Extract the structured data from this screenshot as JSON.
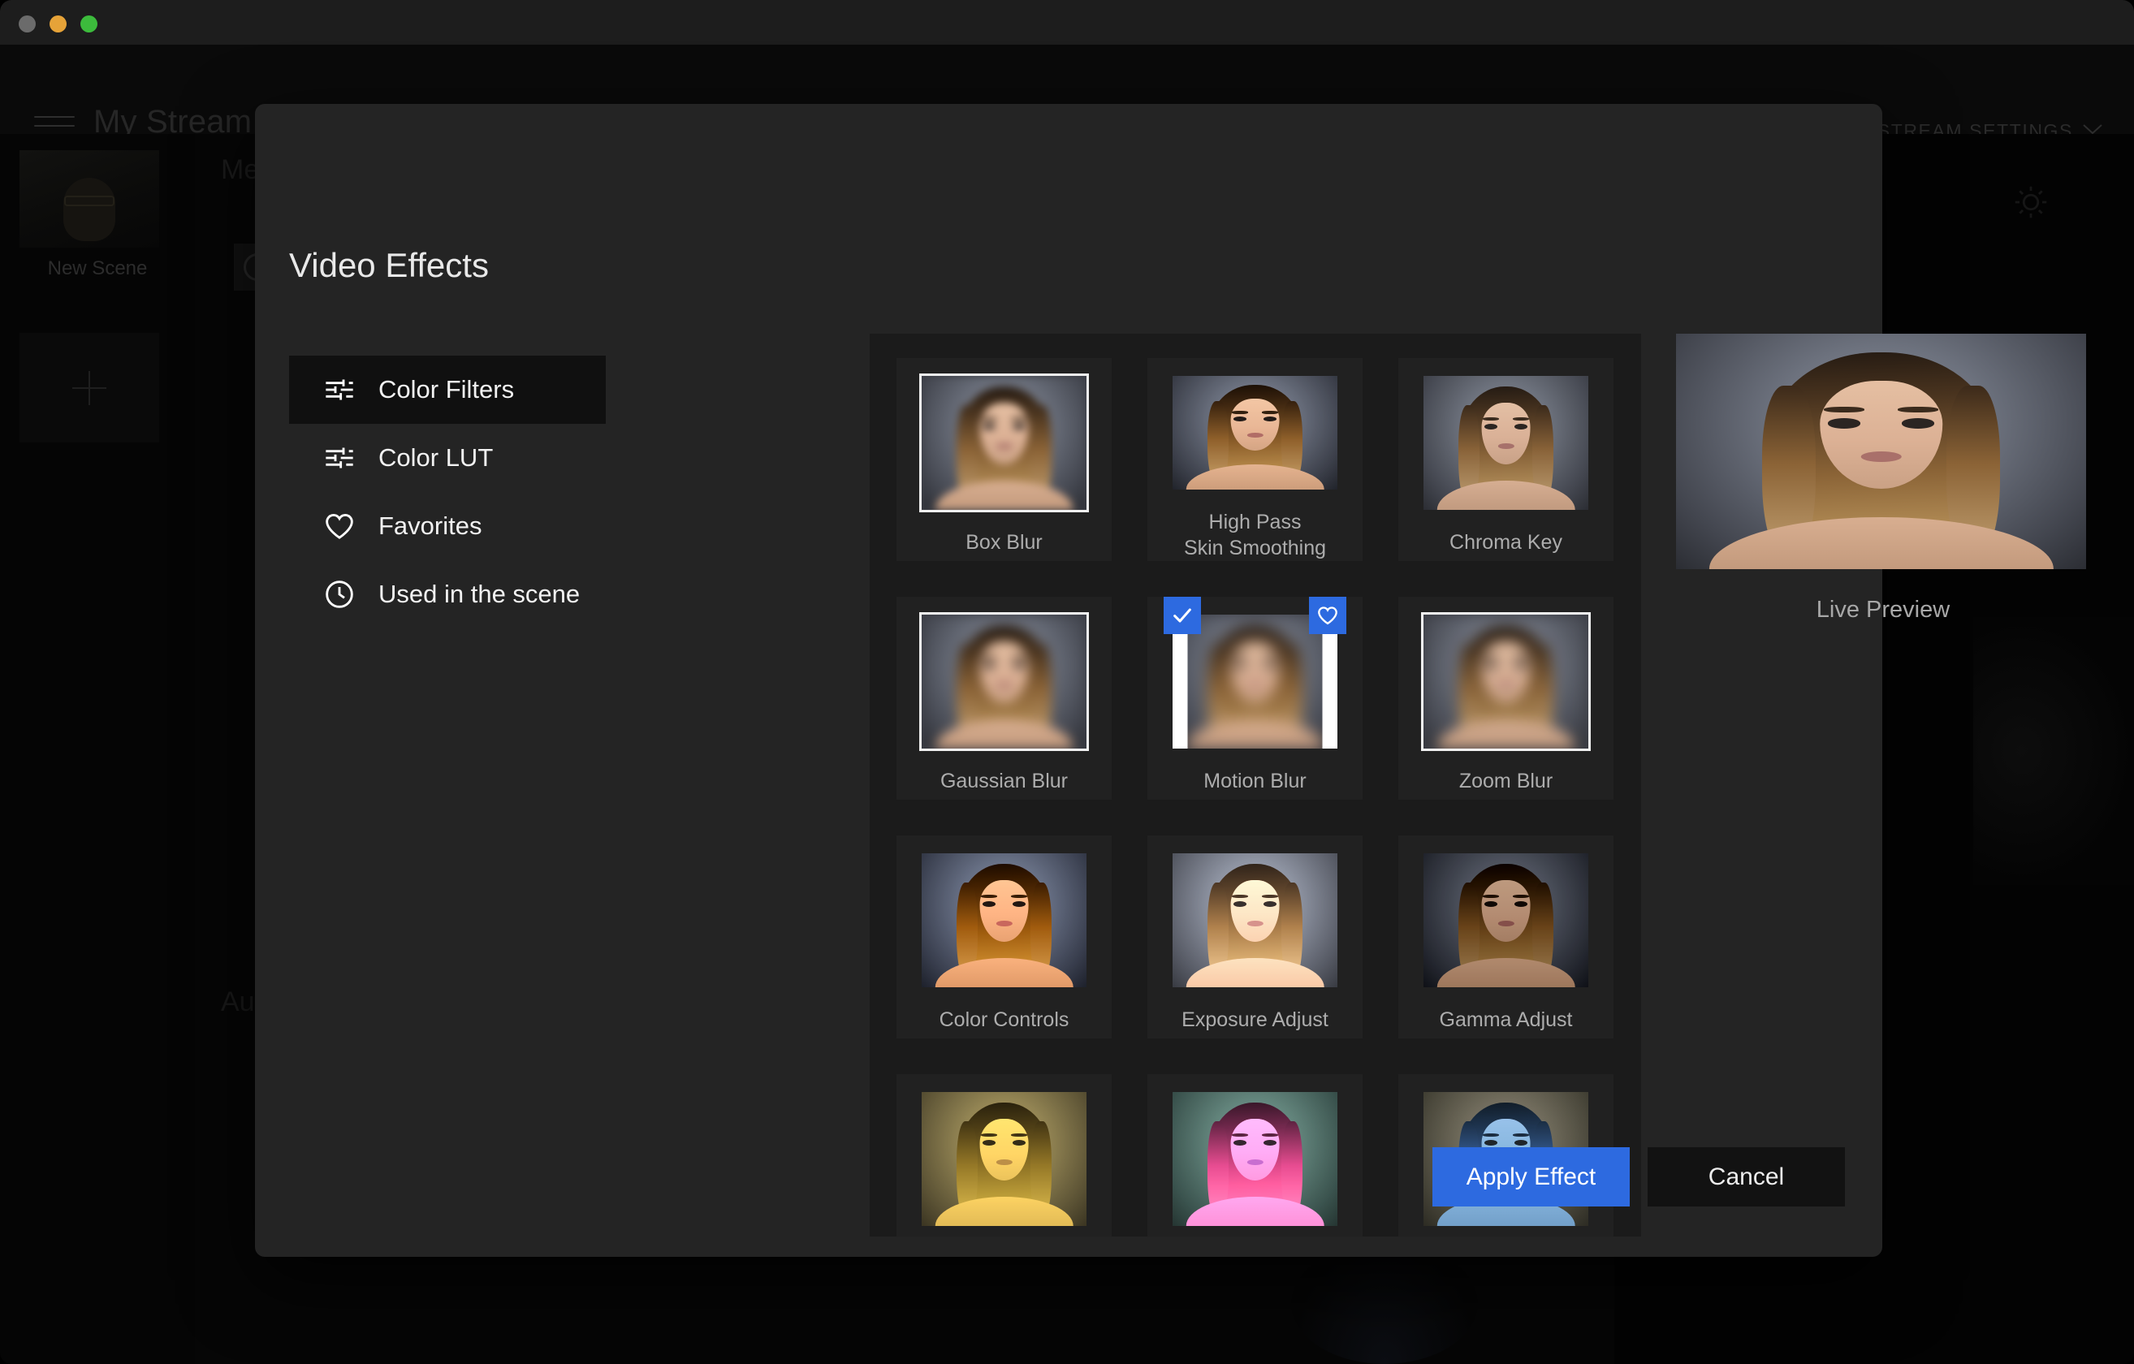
{
  "window": {
    "traffic_lights": [
      "close",
      "minimize",
      "maximize"
    ],
    "app_title": "My Stream",
    "menu_icon": "hamburger-icon",
    "edit_icon": "pencil-icon",
    "record_icon": "record-camera-icon",
    "stream_settings_label": "STREAM SETTINGS",
    "stream_settings_chevron": "chevron-down-icon"
  },
  "background": {
    "scene": {
      "label": "New Scene",
      "add_label": "+"
    },
    "media_label": "Me",
    "audio_label": "Au",
    "brightness_icon": "brightness-icon"
  },
  "dialog": {
    "title": "Video Effects",
    "sidebar": [
      {
        "label": "Color Filters",
        "icon": "sliders-icon",
        "active": true
      },
      {
        "label": "Color LUT",
        "icon": "sliders-icon",
        "active": false
      },
      {
        "label": "Favorites",
        "icon": "heart-icon",
        "active": false
      },
      {
        "label": "Used in the scene",
        "icon": "clock-icon",
        "active": false
      }
    ],
    "effects": [
      {
        "label": "Box Blur",
        "fx": "fx-boxblur",
        "outlined": true,
        "checked": false,
        "favorite": false
      },
      {
        "label": "High Pass\nSkin Smoothing",
        "fx": "fx-highpass",
        "outlined": false,
        "checked": false,
        "favorite": false
      },
      {
        "label": "Chroma Key",
        "fx": "fx-chroma",
        "outlined": false,
        "checked": false,
        "favorite": false
      },
      {
        "label": "Gaussian Blur",
        "fx": "fx-gauss",
        "outlined": true,
        "checked": false,
        "favorite": false
      },
      {
        "label": "Motion Blur",
        "fx": "fx-motion",
        "outlined": false,
        "checked": true,
        "favorite": true
      },
      {
        "label": "Zoom Blur",
        "fx": "fx-zoom",
        "outlined": true,
        "checked": false,
        "favorite": false
      },
      {
        "label": "Color Controls",
        "fx": "fx-colorctrl",
        "outlined": false,
        "checked": false,
        "favorite": false
      },
      {
        "label": "Exposure Adjust",
        "fx": "fx-exposure",
        "outlined": false,
        "checked": false,
        "favorite": false
      },
      {
        "label": "Gamma Adjust",
        "fx": "fx-gamma",
        "outlined": false,
        "checked": false,
        "favorite": false
      },
      {
        "label": "",
        "fx": "fx-yellow",
        "outlined": false,
        "checked": false,
        "favorite": false
      },
      {
        "label": "",
        "fx": "fx-magenta",
        "outlined": false,
        "checked": false,
        "favorite": false
      },
      {
        "label": "",
        "fx": "fx-blue",
        "outlined": false,
        "checked": false,
        "favorite": false
      }
    ],
    "preview": {
      "label": "Live Preview"
    },
    "footer": {
      "apply_label": "Apply Effect",
      "cancel_label": "Cancel"
    }
  },
  "colors": {
    "accent_blue": "#2d6ae0",
    "dialog_bg": "#242424",
    "grid_bg": "#1b1b1b",
    "card_bg": "#212121",
    "app_bg": "#060606",
    "label_gray": "#adadad"
  }
}
